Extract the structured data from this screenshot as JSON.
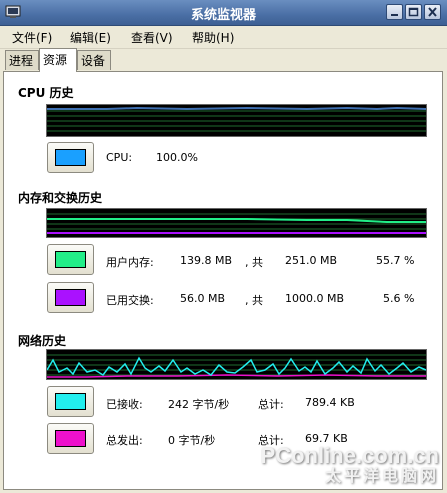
{
  "window": {
    "title": "系统监视器"
  },
  "menubar": {
    "items": [
      "文件(F)",
      "编辑(E)",
      "查看(V)",
      "帮助(H)"
    ]
  },
  "tabs": [
    "进程",
    "资源",
    "设备"
  ],
  "cpu": {
    "heading": "CPU 历史",
    "label": "CPU:",
    "value": "100.0%",
    "color": "#1aa0ff",
    "line_color": "#3f6fb0"
  },
  "memory": {
    "heading": "内存和交换历史",
    "mem_label": "用户内存:",
    "mem_used": "139.8 MB",
    "mem_sep": ", 共",
    "mem_total": "251.0 MB",
    "mem_percent": "55.7 %",
    "mem_color": "#22ee88",
    "swap_label": "已用交换:",
    "swap_used": "56.0 MB",
    "swap_sep": ", 共",
    "swap_total": "1000.0 MB",
    "swap_percent": "5.6 %",
    "swap_color": "#aa11ff"
  },
  "network": {
    "heading": "网络历史",
    "recv_label": "已接收:",
    "recv_rate": "242 字节/秒",
    "recv_total_label": "总计:",
    "recv_total": "789.4 KB",
    "recv_color": "#22eeee",
    "send_label": "总发出:",
    "send_rate": "0 字节/秒",
    "send_total_label": "总计:",
    "send_total": "69.7 KB",
    "send_color": "#ee11cc"
  },
  "watermark": {
    "line1": "PConline.com.cn",
    "line2": "太平洋电脑网"
  }
}
